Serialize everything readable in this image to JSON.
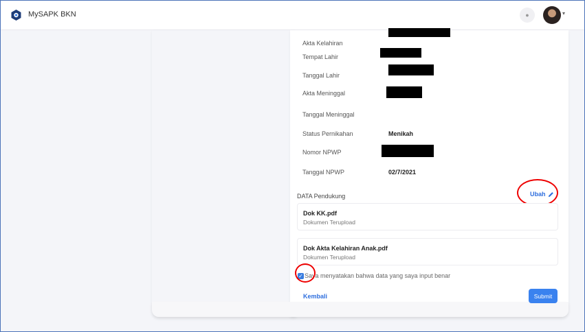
{
  "app": {
    "title": "MySAPK BKN"
  },
  "header": {
    "bell_icon": "bell-icon",
    "avatar_icon": "user-avatar",
    "caret": "▾"
  },
  "fields": [
    {
      "label": "Akta Kelahiran",
      "value": ""
    },
    {
      "label": "Tempat Lahir",
      "value": ""
    },
    {
      "label": "Tanggal Lahir",
      "value": ""
    },
    {
      "label": "Akta Meninggal",
      "value": ""
    },
    {
      "label": "Tanggal Meninggal",
      "value": ""
    },
    {
      "label": "Status Pernikahan",
      "value": "Menikah"
    },
    {
      "label": "Nomor NPWP",
      "value": ""
    },
    {
      "label": "Tanggal NPWP",
      "value": "02/7/2021"
    }
  ],
  "supporting": {
    "title": "DATA Pendukung",
    "edit_label": "Ubah",
    "documents": [
      {
        "name": "Dok KK.pdf",
        "status": "Dokumen Terupload"
      },
      {
        "name": "Dok Akta Kelahiran Anak.pdf",
        "status": "Dokumen Terupload"
      }
    ]
  },
  "declaration": {
    "checked": true,
    "label": "Saya menyatakan bahwa data yang saya input benar"
  },
  "actions": {
    "back_label": "Kembali",
    "submit_label": "Submit"
  },
  "colors": {
    "accent": "#2f6fde",
    "button": "#3a82ef",
    "annotation": "#e00000"
  }
}
